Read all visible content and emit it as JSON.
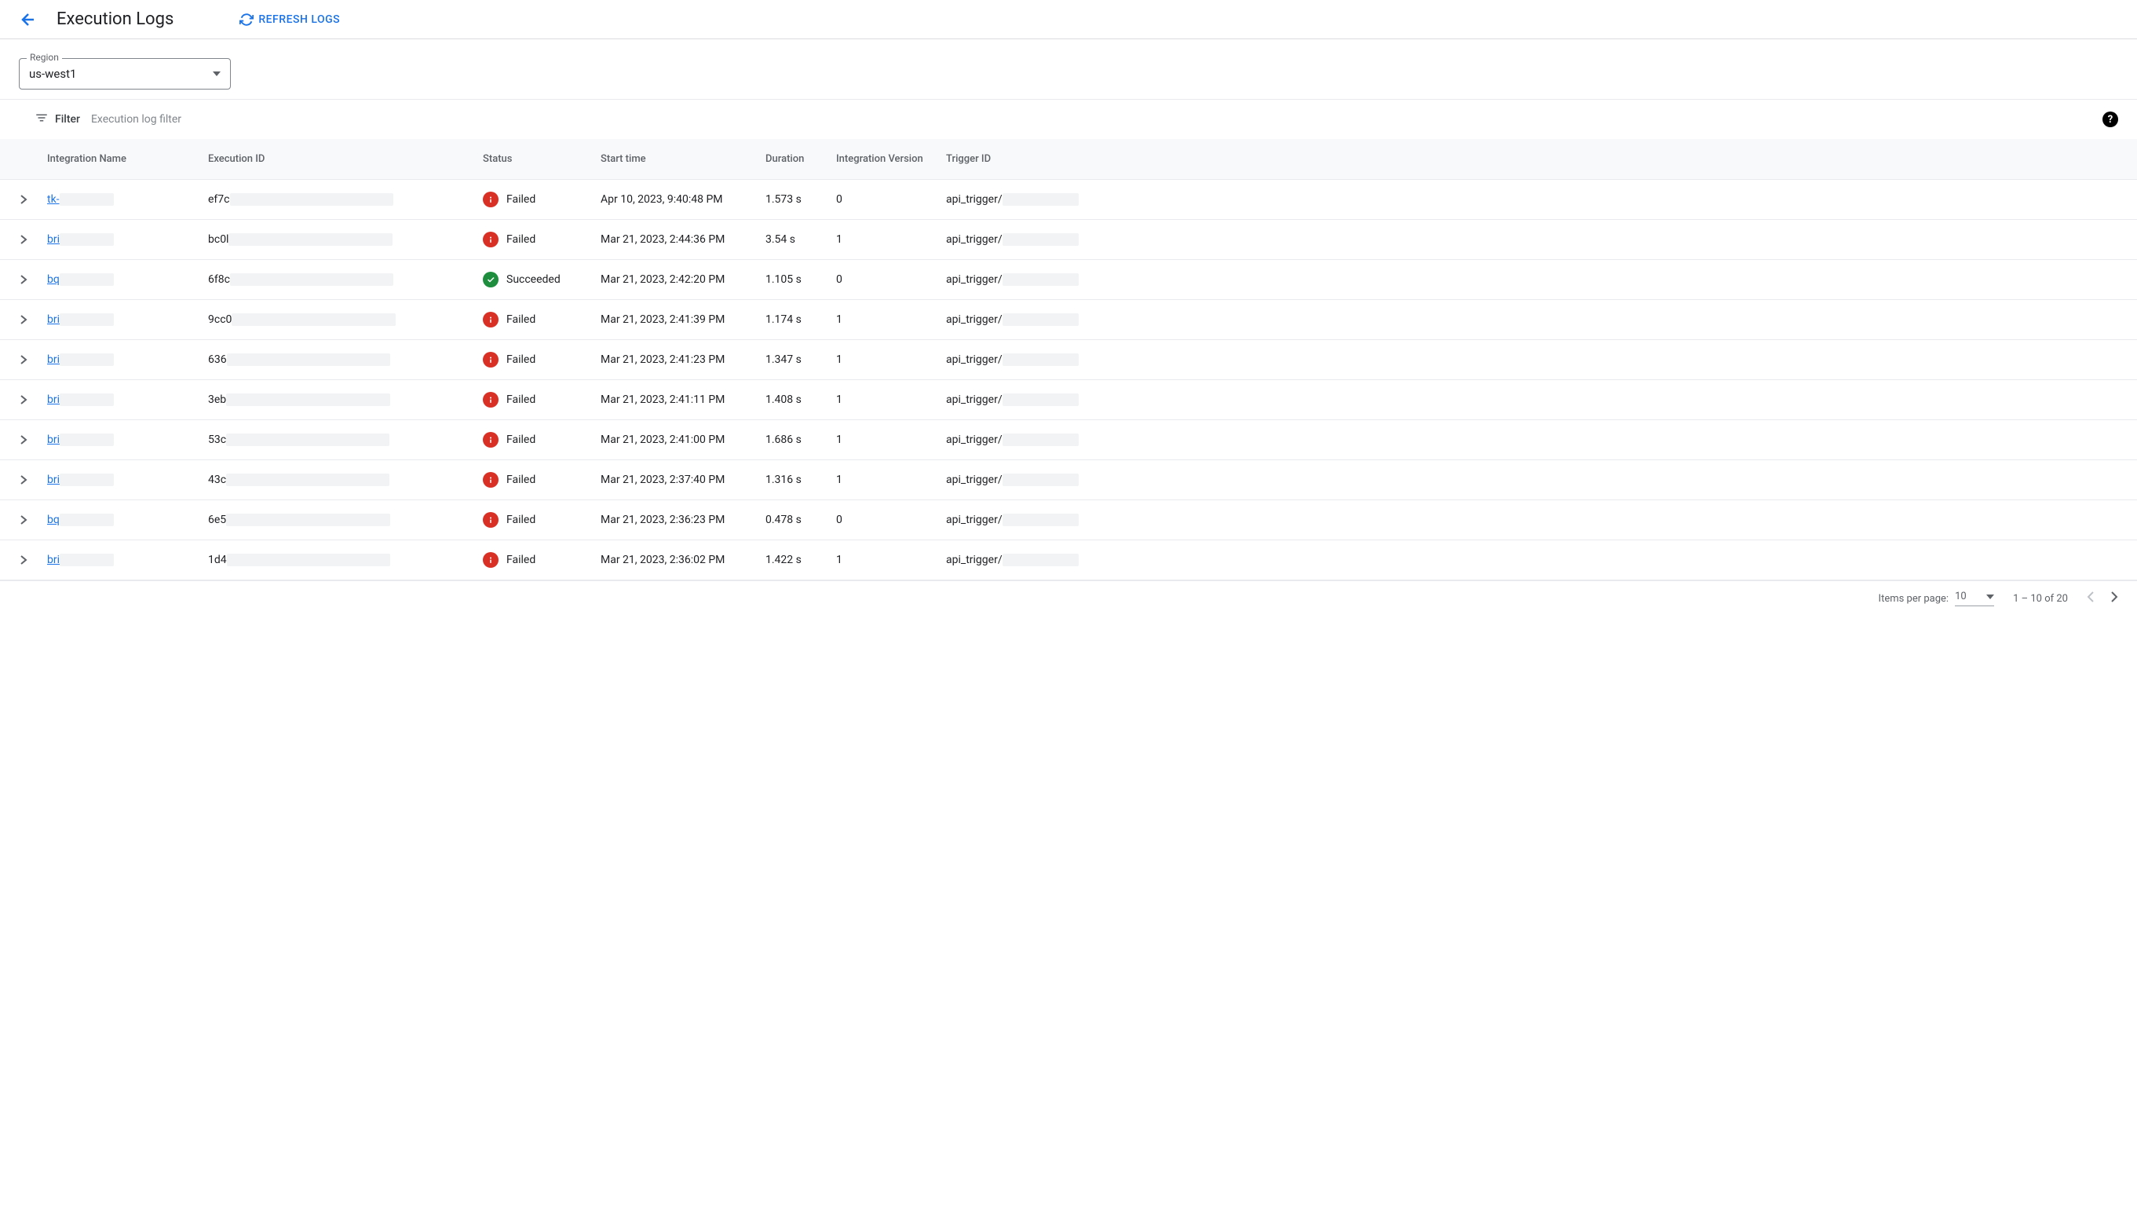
{
  "header": {
    "title": "Execution Logs",
    "refresh_label": "REFRESH LOGS"
  },
  "region": {
    "label": "Region",
    "value": "us-west1"
  },
  "filter": {
    "label": "Filter",
    "placeholder": "Execution log filter"
  },
  "table": {
    "columns": {
      "name": "Integration Name",
      "execid": "Execution ID",
      "status": "Status",
      "start": "Start time",
      "duration": "Duration",
      "version": "Integration Version",
      "trigger": "Trigger ID"
    },
    "rows": [
      {
        "name": "tk-",
        "execid": "ef7c",
        "status": "Failed",
        "start": "Apr 10, 2023, 9:40:48 PM",
        "duration": "1.573 s",
        "version": "0",
        "trigger": "api_trigger/"
      },
      {
        "name": "bri",
        "execid": "bc0l",
        "status": "Failed",
        "start": "Mar 21, 2023, 2:44:36 PM",
        "duration": "3.54 s",
        "version": "1",
        "trigger": "api_trigger/"
      },
      {
        "name": "bq",
        "execid": "6f8c",
        "status": "Succeeded",
        "start": "Mar 21, 2023, 2:42:20 PM",
        "duration": "1.105 s",
        "version": "0",
        "trigger": "api_trigger/"
      },
      {
        "name": "bri",
        "execid": "9cc0",
        "status": "Failed",
        "start": "Mar 21, 2023, 2:41:39 PM",
        "duration": "1.174 s",
        "version": "1",
        "trigger": "api_trigger/"
      },
      {
        "name": "bri",
        "execid": "636",
        "status": "Failed",
        "start": "Mar 21, 2023, 2:41:23 PM",
        "duration": "1.347 s",
        "version": "1",
        "trigger": "api_trigger/"
      },
      {
        "name": "bri",
        "execid": "3eb",
        "status": "Failed",
        "start": "Mar 21, 2023, 2:41:11 PM",
        "duration": "1.408 s",
        "version": "1",
        "trigger": "api_trigger/"
      },
      {
        "name": "bri",
        "execid": "53c",
        "status": "Failed",
        "start": "Mar 21, 2023, 2:41:00 PM",
        "duration": "1.686 s",
        "version": "1",
        "trigger": "api_trigger/"
      },
      {
        "name": "bri",
        "execid": "43c",
        "status": "Failed",
        "start": "Mar 21, 2023, 2:37:40 PM",
        "duration": "1.316 s",
        "version": "1",
        "trigger": "api_trigger/"
      },
      {
        "name": "bq",
        "execid": "6e5",
        "status": "Failed",
        "start": "Mar 21, 2023, 2:36:23 PM",
        "duration": "0.478 s",
        "version": "0",
        "trigger": "api_trigger/"
      },
      {
        "name": "bri",
        "execid": "1d4",
        "status": "Failed",
        "start": "Mar 21, 2023, 2:36:02 PM",
        "duration": "1.422 s",
        "version": "1",
        "trigger": "api_trigger/"
      }
    ]
  },
  "pagination": {
    "items_label": "Items per page:",
    "items_value": "10",
    "range": "1 – 10 of 20"
  }
}
